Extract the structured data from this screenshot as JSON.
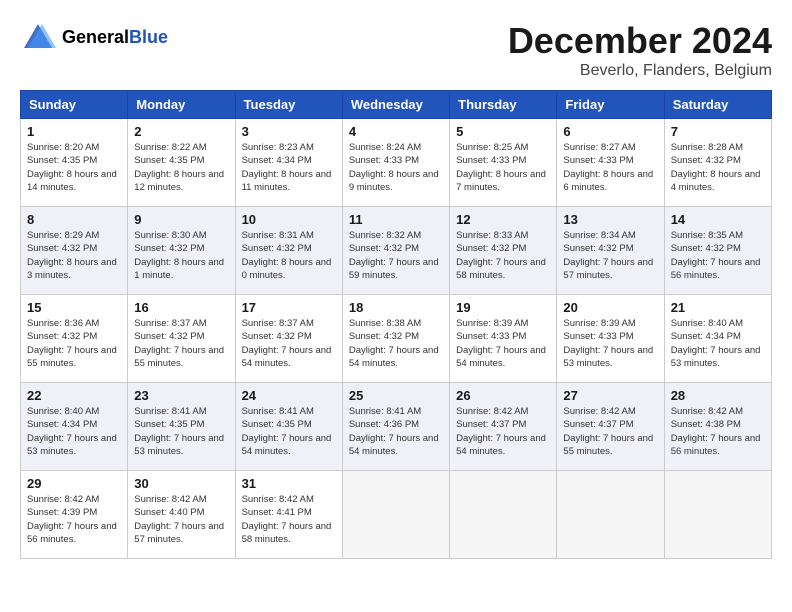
{
  "header": {
    "logo_line1": "General",
    "logo_line2": "Blue",
    "month_title": "December 2024",
    "location": "Beverlo, Flanders, Belgium"
  },
  "days_of_week": [
    "Sunday",
    "Monday",
    "Tuesday",
    "Wednesday",
    "Thursday",
    "Friday",
    "Saturday"
  ],
  "weeks": [
    [
      {
        "day": "1",
        "sunrise": "Sunrise: 8:20 AM",
        "sunset": "Sunset: 4:35 PM",
        "daylight": "Daylight: 8 hours and 14 minutes."
      },
      {
        "day": "2",
        "sunrise": "Sunrise: 8:22 AM",
        "sunset": "Sunset: 4:35 PM",
        "daylight": "Daylight: 8 hours and 12 minutes."
      },
      {
        "day": "3",
        "sunrise": "Sunrise: 8:23 AM",
        "sunset": "Sunset: 4:34 PM",
        "daylight": "Daylight: 8 hours and 11 minutes."
      },
      {
        "day": "4",
        "sunrise": "Sunrise: 8:24 AM",
        "sunset": "Sunset: 4:33 PM",
        "daylight": "Daylight: 8 hours and 9 minutes."
      },
      {
        "day": "5",
        "sunrise": "Sunrise: 8:25 AM",
        "sunset": "Sunset: 4:33 PM",
        "daylight": "Daylight: 8 hours and 7 minutes."
      },
      {
        "day": "6",
        "sunrise": "Sunrise: 8:27 AM",
        "sunset": "Sunset: 4:33 PM",
        "daylight": "Daylight: 8 hours and 6 minutes."
      },
      {
        "day": "7",
        "sunrise": "Sunrise: 8:28 AM",
        "sunset": "Sunset: 4:32 PM",
        "daylight": "Daylight: 8 hours and 4 minutes."
      }
    ],
    [
      {
        "day": "8",
        "sunrise": "Sunrise: 8:29 AM",
        "sunset": "Sunset: 4:32 PM",
        "daylight": "Daylight: 8 hours and 3 minutes."
      },
      {
        "day": "9",
        "sunrise": "Sunrise: 8:30 AM",
        "sunset": "Sunset: 4:32 PM",
        "daylight": "Daylight: 8 hours and 1 minute."
      },
      {
        "day": "10",
        "sunrise": "Sunrise: 8:31 AM",
        "sunset": "Sunset: 4:32 PM",
        "daylight": "Daylight: 8 hours and 0 minutes."
      },
      {
        "day": "11",
        "sunrise": "Sunrise: 8:32 AM",
        "sunset": "Sunset: 4:32 PM",
        "daylight": "Daylight: 7 hours and 59 minutes."
      },
      {
        "day": "12",
        "sunrise": "Sunrise: 8:33 AM",
        "sunset": "Sunset: 4:32 PM",
        "daylight": "Daylight: 7 hours and 58 minutes."
      },
      {
        "day": "13",
        "sunrise": "Sunrise: 8:34 AM",
        "sunset": "Sunset: 4:32 PM",
        "daylight": "Daylight: 7 hours and 57 minutes."
      },
      {
        "day": "14",
        "sunrise": "Sunrise: 8:35 AM",
        "sunset": "Sunset: 4:32 PM",
        "daylight": "Daylight: 7 hours and 56 minutes."
      }
    ],
    [
      {
        "day": "15",
        "sunrise": "Sunrise: 8:36 AM",
        "sunset": "Sunset: 4:32 PM",
        "daylight": "Daylight: 7 hours and 55 minutes."
      },
      {
        "day": "16",
        "sunrise": "Sunrise: 8:37 AM",
        "sunset": "Sunset: 4:32 PM",
        "daylight": "Daylight: 7 hours and 55 minutes."
      },
      {
        "day": "17",
        "sunrise": "Sunrise: 8:37 AM",
        "sunset": "Sunset: 4:32 PM",
        "daylight": "Daylight: 7 hours and 54 minutes."
      },
      {
        "day": "18",
        "sunrise": "Sunrise: 8:38 AM",
        "sunset": "Sunset: 4:32 PM",
        "daylight": "Daylight: 7 hours and 54 minutes."
      },
      {
        "day": "19",
        "sunrise": "Sunrise: 8:39 AM",
        "sunset": "Sunset: 4:33 PM",
        "daylight": "Daylight: 7 hours and 54 minutes."
      },
      {
        "day": "20",
        "sunrise": "Sunrise: 8:39 AM",
        "sunset": "Sunset: 4:33 PM",
        "daylight": "Daylight: 7 hours and 53 minutes."
      },
      {
        "day": "21",
        "sunrise": "Sunrise: 8:40 AM",
        "sunset": "Sunset: 4:34 PM",
        "daylight": "Daylight: 7 hours and 53 minutes."
      }
    ],
    [
      {
        "day": "22",
        "sunrise": "Sunrise: 8:40 AM",
        "sunset": "Sunset: 4:34 PM",
        "daylight": "Daylight: 7 hours and 53 minutes."
      },
      {
        "day": "23",
        "sunrise": "Sunrise: 8:41 AM",
        "sunset": "Sunset: 4:35 PM",
        "daylight": "Daylight: 7 hours and 53 minutes."
      },
      {
        "day": "24",
        "sunrise": "Sunrise: 8:41 AM",
        "sunset": "Sunset: 4:35 PM",
        "daylight": "Daylight: 7 hours and 54 minutes."
      },
      {
        "day": "25",
        "sunrise": "Sunrise: 8:41 AM",
        "sunset": "Sunset: 4:36 PM",
        "daylight": "Daylight: 7 hours and 54 minutes."
      },
      {
        "day": "26",
        "sunrise": "Sunrise: 8:42 AM",
        "sunset": "Sunset: 4:37 PM",
        "daylight": "Daylight: 7 hours and 54 minutes."
      },
      {
        "day": "27",
        "sunrise": "Sunrise: 8:42 AM",
        "sunset": "Sunset: 4:37 PM",
        "daylight": "Daylight: 7 hours and 55 minutes."
      },
      {
        "day": "28",
        "sunrise": "Sunrise: 8:42 AM",
        "sunset": "Sunset: 4:38 PM",
        "daylight": "Daylight: 7 hours and 56 minutes."
      }
    ],
    [
      {
        "day": "29",
        "sunrise": "Sunrise: 8:42 AM",
        "sunset": "Sunset: 4:39 PM",
        "daylight": "Daylight: 7 hours and 56 minutes."
      },
      {
        "day": "30",
        "sunrise": "Sunrise: 8:42 AM",
        "sunset": "Sunset: 4:40 PM",
        "daylight": "Daylight: 7 hours and 57 minutes."
      },
      {
        "day": "31",
        "sunrise": "Sunrise: 8:42 AM",
        "sunset": "Sunset: 4:41 PM",
        "daylight": "Daylight: 7 hours and 58 minutes."
      },
      null,
      null,
      null,
      null
    ]
  ]
}
